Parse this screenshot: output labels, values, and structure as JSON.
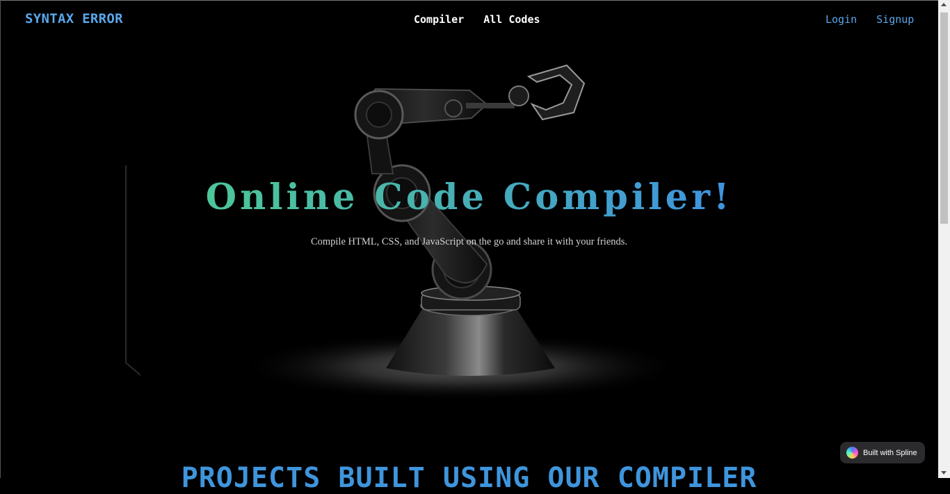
{
  "nav": {
    "brand": "SYNTAX ERROR",
    "links": [
      {
        "label": "Compiler"
      },
      {
        "label": "All Codes"
      }
    ],
    "auth": {
      "login": "Login",
      "signup": "Signup"
    }
  },
  "hero": {
    "title": "Online Code Compiler!",
    "subtitle": "Compile HTML, CSS, and JavaScript on the go and share it with your friends."
  },
  "projects": {
    "heading": "PROJECTS BUILT USING OUR COMPILER"
  },
  "badge": {
    "label": "Built with Spline"
  },
  "colors": {
    "accent": "#5aa7ea",
    "gradient_start": "#4fd787",
    "gradient_end": "#3a82ee",
    "background": "#000000"
  }
}
